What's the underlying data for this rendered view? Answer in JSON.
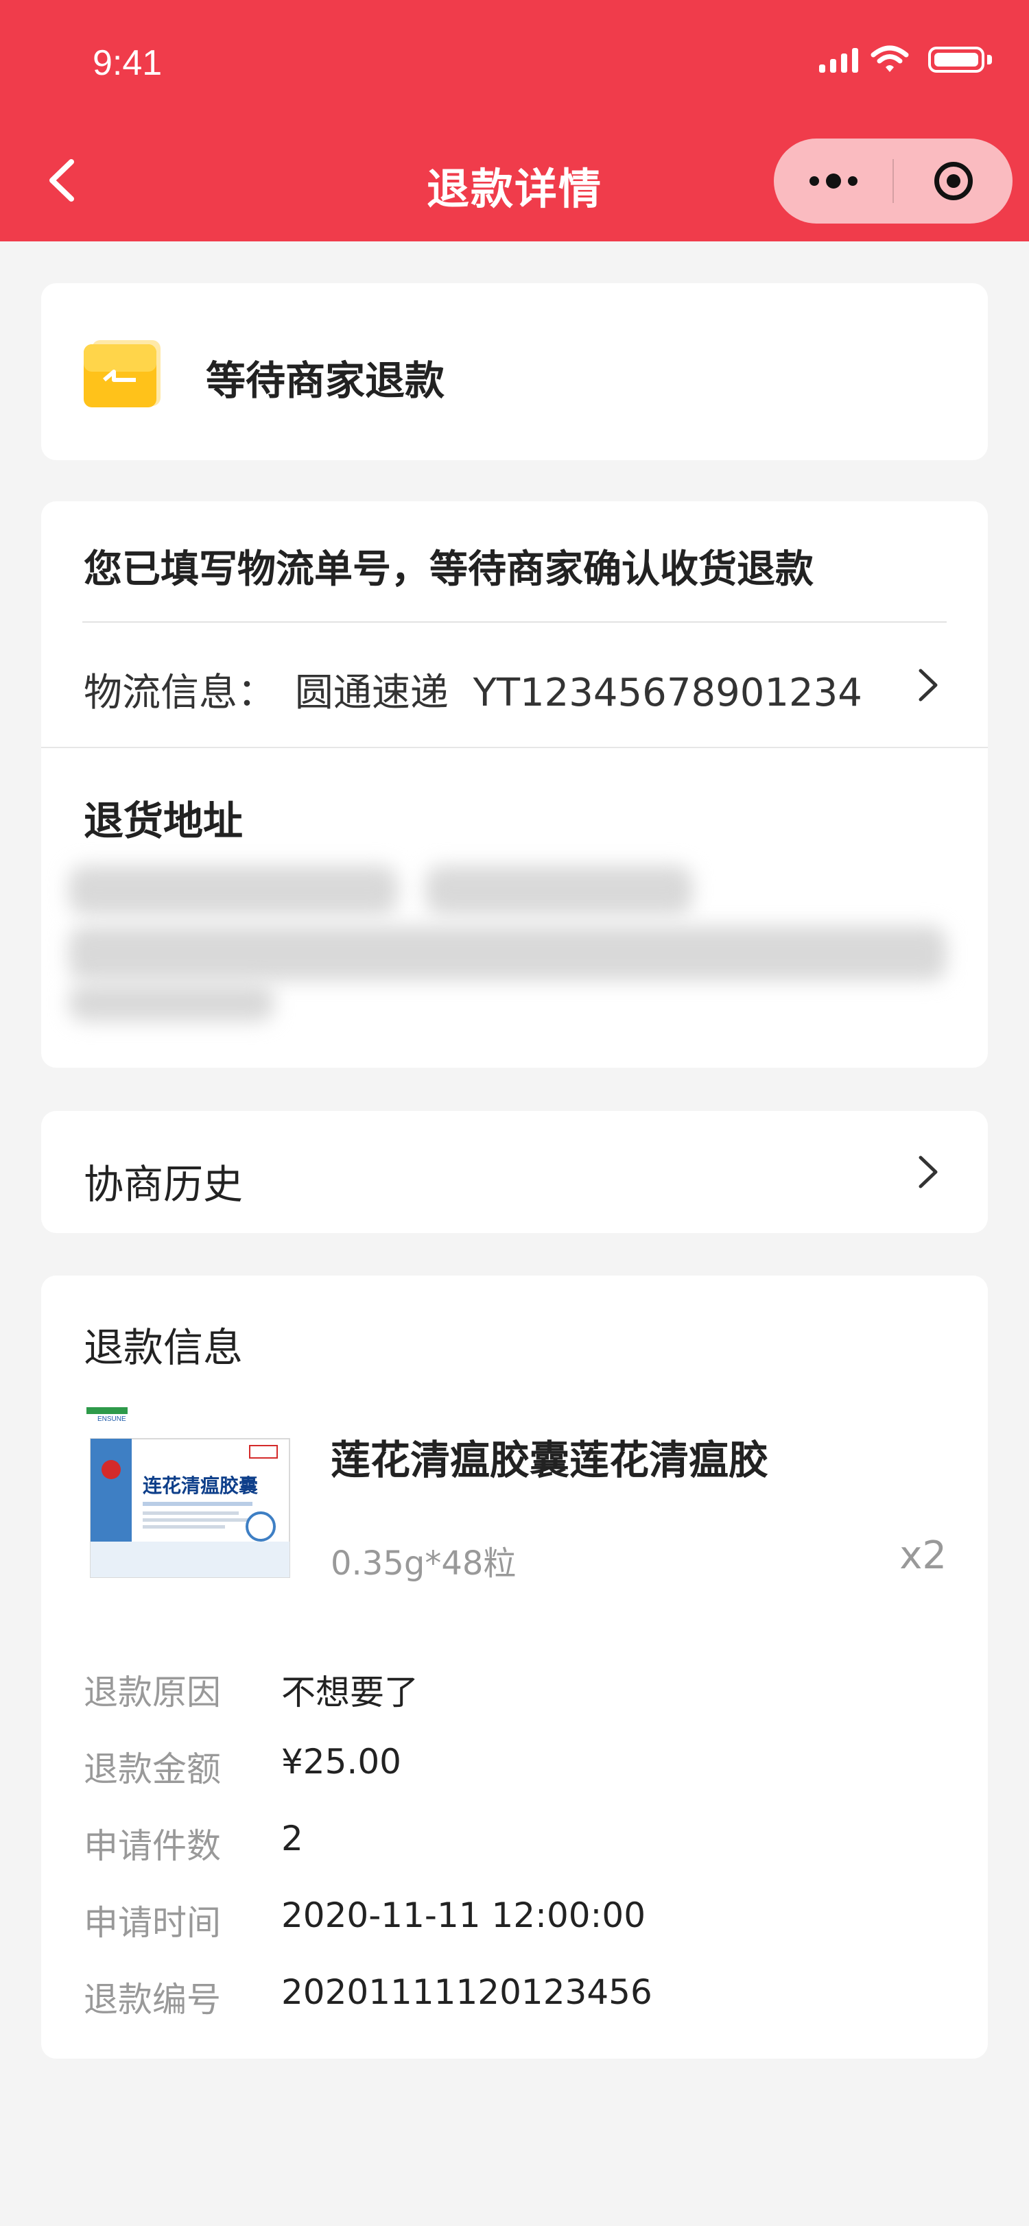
{
  "status_bar": {
    "time": "9:41"
  },
  "nav": {
    "title": "退款详情"
  },
  "status_card": {
    "text": "等待商家退款"
  },
  "logistics": {
    "notice": "您已填写物流单号，等待商家确认收货退款",
    "label": "物流信息：",
    "carrier": "圆通速递",
    "tracking_no": "YT12345678901234",
    "return_address_title": "退货地址"
  },
  "history": {
    "label": "协商历史"
  },
  "refund": {
    "title": "退款信息",
    "product": {
      "name": "莲花清瘟胶囊莲花清瘟胶",
      "spec": "0.35g*48粒",
      "qty": "x2",
      "box_title": "连花清瘟胶囊",
      "brand": "ENSUNE"
    },
    "rows": [
      {
        "label": "退款原因",
        "value": "不想要了"
      },
      {
        "label": "退款金额",
        "value": "¥25.00"
      },
      {
        "label": "申请件数",
        "value": "2"
      },
      {
        "label": "申请时间",
        "value": "2020-11-11  12:00:00"
      },
      {
        "label": "退款编号",
        "value": "20201111120123456"
      }
    ]
  },
  "colors": {
    "brand_red": "#f03c4b",
    "folder_yellow": "#ffc21a",
    "background": "#f4f4f4"
  }
}
